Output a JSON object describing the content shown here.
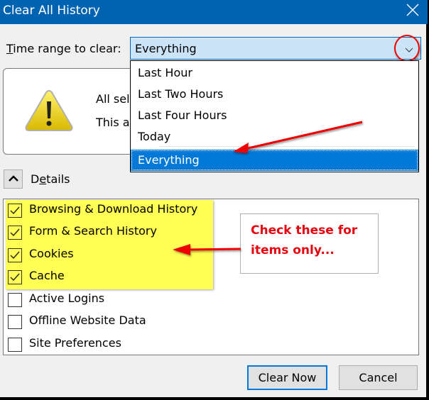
{
  "window": {
    "title": "Clear All History",
    "close_icon": "close-icon"
  },
  "time_range": {
    "label_prefix": "T",
    "label_rest": "ime range to clear:",
    "selected": "Everything",
    "options": [
      "Last Hour",
      "Last Two Hours",
      "Last Four Hours",
      "Today",
      "Everything"
    ],
    "selected_index": 4
  },
  "info": {
    "icon": "warning-icon",
    "line1": "All selected items will be cleared.",
    "line2": "This action cannot be undone."
  },
  "details": {
    "label_prefix": "D",
    "label_underlined": "e",
    "label_rest": "tails",
    "expanded": true,
    "items": [
      {
        "label": "Browsing & Download History",
        "checked": true
      },
      {
        "label": "Form & Search History",
        "checked": true
      },
      {
        "label": "Cookies",
        "checked": true
      },
      {
        "label": "Cache",
        "checked": true
      },
      {
        "label": "Active Logins",
        "checked": false
      },
      {
        "label": "Offline Website Data",
        "checked": false
      },
      {
        "label": "Site Preferences",
        "checked": false
      }
    ]
  },
  "annotation": {
    "line1": "Check these for",
    "line2": "items only...",
    "color": "#e8000e",
    "highlight_color": "#ffff55"
  },
  "buttons": {
    "clear_now": "Clear Now",
    "cancel": "Cancel"
  },
  "colors": {
    "titlebar": "#0063b1",
    "select_bg": "#cce4f7",
    "selected_option": "#0078d7"
  }
}
